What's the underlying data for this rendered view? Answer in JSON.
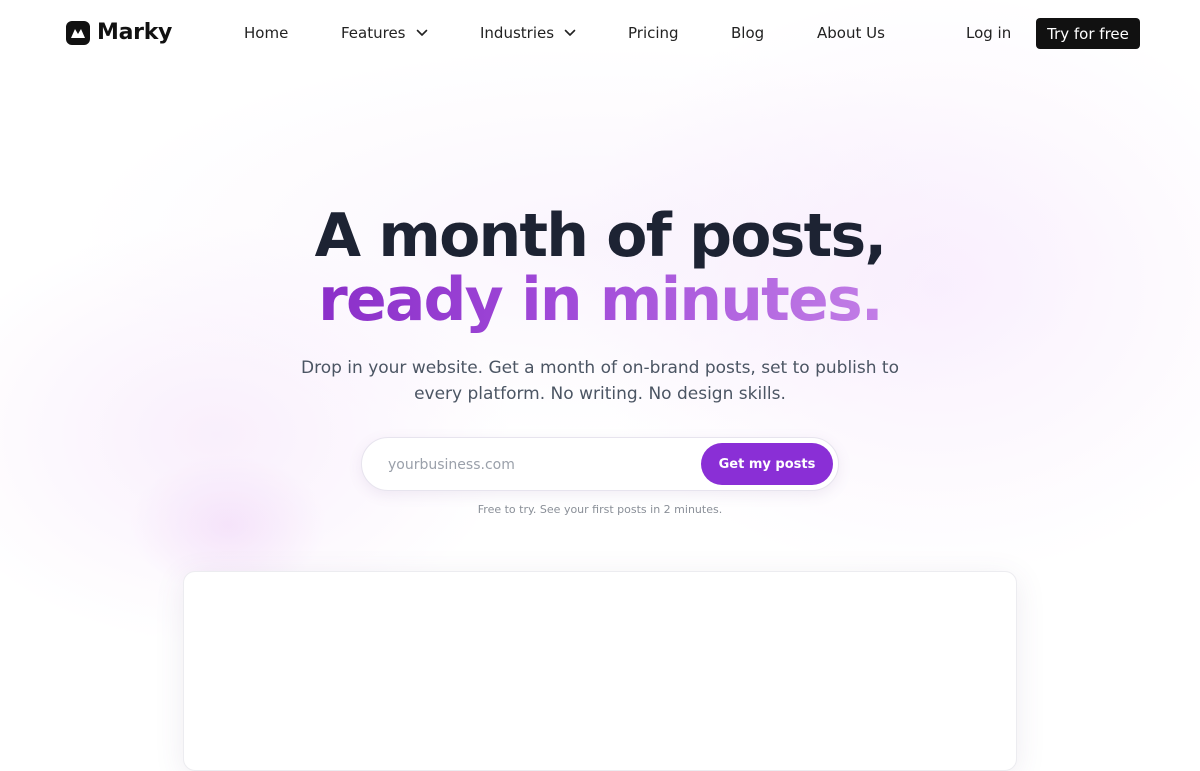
{
  "brand": {
    "name": "Marky",
    "logo_icon": "marky-logo-icon"
  },
  "nav": {
    "items": [
      {
        "label": "Home"
      },
      {
        "label": "Features",
        "icon": "chevron-down-icon"
      },
      {
        "label": "Industries",
        "icon": "chevron-down-icon"
      },
      {
        "label": "Pricing"
      },
      {
        "label": "Blog"
      },
      {
        "label": "About Us"
      }
    ],
    "login_label": "Log in",
    "cta_label": "Try for free"
  },
  "hero": {
    "title_line1": "A month of posts,",
    "title_line2": "ready in minutes.",
    "subtitle": "Drop in your website. Get a month of on-brand posts, set to publish to every platform. No writing. No design skills.",
    "input_placeholder": "yourbusiness.com",
    "button_label": "Get my posts",
    "footnote": "Free to try. See your first posts in 2 minutes."
  },
  "colors": {
    "accent": "#8a2fd6",
    "dark": "#111111",
    "heading": "#1d2333"
  }
}
